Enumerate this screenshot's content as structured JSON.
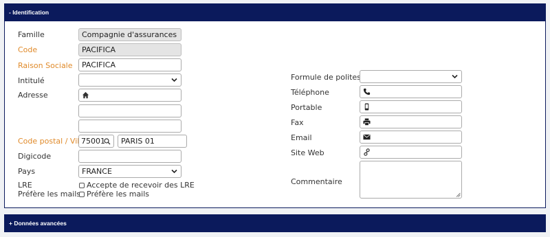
{
  "sections": {
    "identification": "- Identification",
    "advanced": "+ Données avancées"
  },
  "left": {
    "famille": {
      "label": "Famille",
      "value": "Compagnie d'assurances"
    },
    "code": {
      "label": "Code",
      "value": "PACIFICA"
    },
    "raison_sociale": {
      "label": "Raison Sociale",
      "value": "PACIFICA"
    },
    "intitule": {
      "label": "Intitulé",
      "value": ""
    },
    "adresse": {
      "label": "Adresse",
      "line1": "",
      "line2": "",
      "line3": ""
    },
    "code_postal": {
      "label": "Code postal / Ville",
      "cp": "75001",
      "ville": "PARIS 01"
    },
    "digicode": {
      "label": "Digicode",
      "value": ""
    },
    "pays": {
      "label": "Pays",
      "value": "FRANCE"
    },
    "lre": {
      "label": "LRE",
      "checkbox_label": "Accepte de recevoir des LRE",
      "checked": false
    },
    "prefere_mails": {
      "label": "Préfère les mails",
      "checkbox_label": "Préfère les mails",
      "checked": false
    }
  },
  "right": {
    "formule": {
      "label": "Formule de politesse",
      "value": ""
    },
    "telephone": {
      "label": "Téléphone",
      "value": ""
    },
    "portable": {
      "label": "Portable",
      "value": ""
    },
    "fax": {
      "label": "Fax",
      "value": ""
    },
    "email": {
      "label": "Email",
      "value": ""
    },
    "site_web": {
      "label": "Site Web",
      "value": ""
    },
    "commentaire": {
      "label": "Commentaire",
      "value": ""
    }
  },
  "colors": {
    "header_bg": "#0b1a5c",
    "required_label": "#e08a2a",
    "readonly_bg": "#e4e4e4"
  }
}
